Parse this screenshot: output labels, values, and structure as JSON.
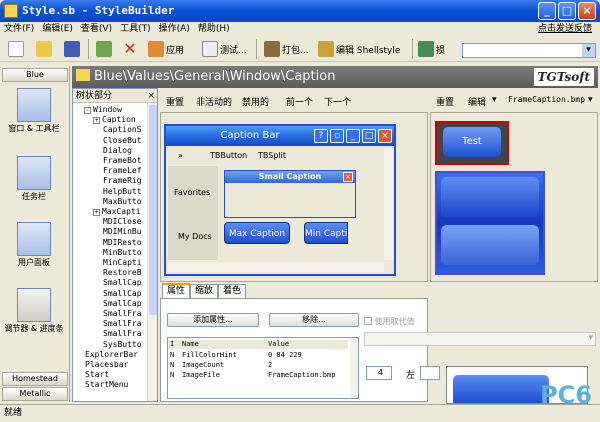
{
  "window": {
    "title": "Style.sb - StyleBuilder"
  },
  "menu": {
    "items": [
      "文件(F)",
      "编辑(E)",
      "查看(V)",
      "工具(T)",
      "操作(A)",
      "帮助(H)"
    ],
    "feedback": "点击发送反馈"
  },
  "toolbar": {
    "apply": "应用",
    "test": "测试...",
    "pack": "打包...",
    "edit_shellstyle": "编辑 Shellstyle",
    "extra": "损"
  },
  "leftbar": {
    "top_group": "Blue",
    "items": [
      "窗口 & 工具栏",
      "任务栏",
      "用户面板",
      "调节器 & 进度条"
    ],
    "groups": [
      "Homestead",
      "Metallic"
    ]
  },
  "path": {
    "text": "Blue\\Values\\General\\Window\\Caption",
    "logo": "TGTsoft"
  },
  "tree": {
    "title": "树状部分",
    "nodes": [
      {
        "t": "Window",
        "exp": "-",
        "lvl": 1
      },
      {
        "t": "Caption",
        "exp": "+",
        "lvl": 2
      },
      {
        "t": "CaptionS",
        "exp": "",
        "lvl": 2
      },
      {
        "t": "CloseBut",
        "exp": "",
        "lvl": 2
      },
      {
        "t": "Dialog",
        "exp": "",
        "lvl": 2
      },
      {
        "t": "FrameBot",
        "exp": "",
        "lvl": 2
      },
      {
        "t": "FrameLef",
        "exp": "",
        "lvl": 2
      },
      {
        "t": "FrameRig",
        "exp": "",
        "lvl": 2
      },
      {
        "t": "HelpButt",
        "exp": "",
        "lvl": 2
      },
      {
        "t": "MaxButto",
        "exp": "",
        "lvl": 2
      },
      {
        "t": "MaxCapti",
        "exp": "+",
        "lvl": 2
      },
      {
        "t": "MDIClose",
        "exp": "",
        "lvl": 2
      },
      {
        "t": "MDIMinBu",
        "exp": "",
        "lvl": 2
      },
      {
        "t": "MDIResto",
        "exp": "",
        "lvl": 2
      },
      {
        "t": "MinButto",
        "exp": "",
        "lvl": 2
      },
      {
        "t": "MinCapti",
        "exp": "",
        "lvl": 2
      },
      {
        "t": "RestoreB",
        "exp": "",
        "lvl": 2
      },
      {
        "t": "SmallCap",
        "exp": "",
        "lvl": 2
      },
      {
        "t": "SmallCap",
        "exp": "",
        "lvl": 2
      },
      {
        "t": "SmallCap",
        "exp": "",
        "lvl": 2
      },
      {
        "t": "SmallFra",
        "exp": "",
        "lvl": 2
      },
      {
        "t": "SmallFra",
        "exp": "",
        "lvl": 2
      },
      {
        "t": "SmallFra",
        "exp": "",
        "lvl": 2
      },
      {
        "t": "SysButto",
        "exp": "",
        "lvl": 2
      },
      {
        "t": "ExplorerBar",
        "exp": "",
        "lvl": 0
      },
      {
        "t": "Placesbar",
        "exp": "",
        "lvl": 0
      },
      {
        "t": "Start",
        "exp": "",
        "lvl": 0
      },
      {
        "t": "StartMenu",
        "exp": "",
        "lvl": 0
      }
    ]
  },
  "preview": {
    "tools": [
      "重置",
      "非活动的",
      "禁用的",
      "前一个",
      "下一个"
    ],
    "caption_title": "Caption Bar",
    "bar_items": [
      "»",
      "TBButton",
      "TBSplit"
    ],
    "favorites": "Favorites",
    "mydocs": "My Docs",
    "small_caption": "Small Caption",
    "max_caption": "Max Caption",
    "min_caption": "Min Capti"
  },
  "image_panel": {
    "reset": "重置",
    "edit": "编辑",
    "file": "FrameCaption.bmp",
    "test": "Test"
  },
  "tabs": [
    "属性",
    "缩放",
    "着色"
  ],
  "props": {
    "add": "添加属性...",
    "remove": "移除...",
    "use_alt": "使用取代值",
    "headers": [
      "I",
      "Name",
      "Value"
    ],
    "rows": [
      {
        "i": "N",
        "name": "FillColorHint",
        "value": "0 84 229"
      },
      {
        "i": "N",
        "name": "ImageCount",
        "value": "2"
      },
      {
        "i": "N",
        "name": "ImageFile",
        "value": "FrameCaption.bmp"
      }
    ]
  },
  "bottom_right": {
    "spin_value": "4",
    "left": "左"
  },
  "status": {
    "text": "就绪"
  },
  "watermark": "PC6"
}
